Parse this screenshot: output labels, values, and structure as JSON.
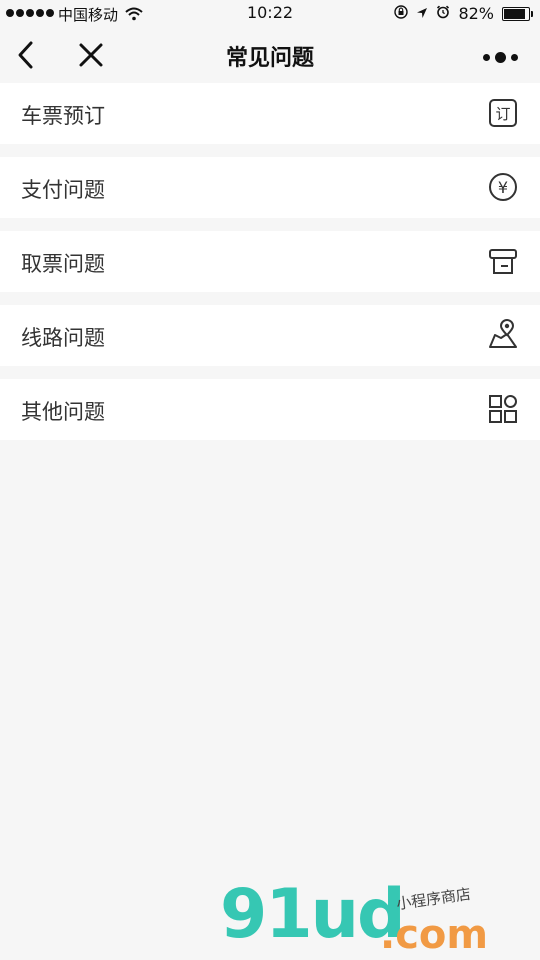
{
  "status_bar": {
    "carrier": "中国移动",
    "time": "10:22",
    "battery": "82%"
  },
  "nav": {
    "title": "常见问题"
  },
  "items": [
    {
      "label": "车票预订",
      "icon": "ticket-booking-icon"
    },
    {
      "label": "支付问题",
      "icon": "yuan-icon"
    },
    {
      "label": "取票问题",
      "icon": "printer-icon"
    },
    {
      "label": "线路问题",
      "icon": "map-pin-icon"
    },
    {
      "label": "其他问题",
      "icon": "grid-icon"
    }
  ],
  "icon_texts": {
    "booking_char": "订",
    "yuan_char": "¥"
  },
  "watermark": {
    "brand": "91ud",
    "domain": ".com",
    "tagline": "小程序商店"
  }
}
